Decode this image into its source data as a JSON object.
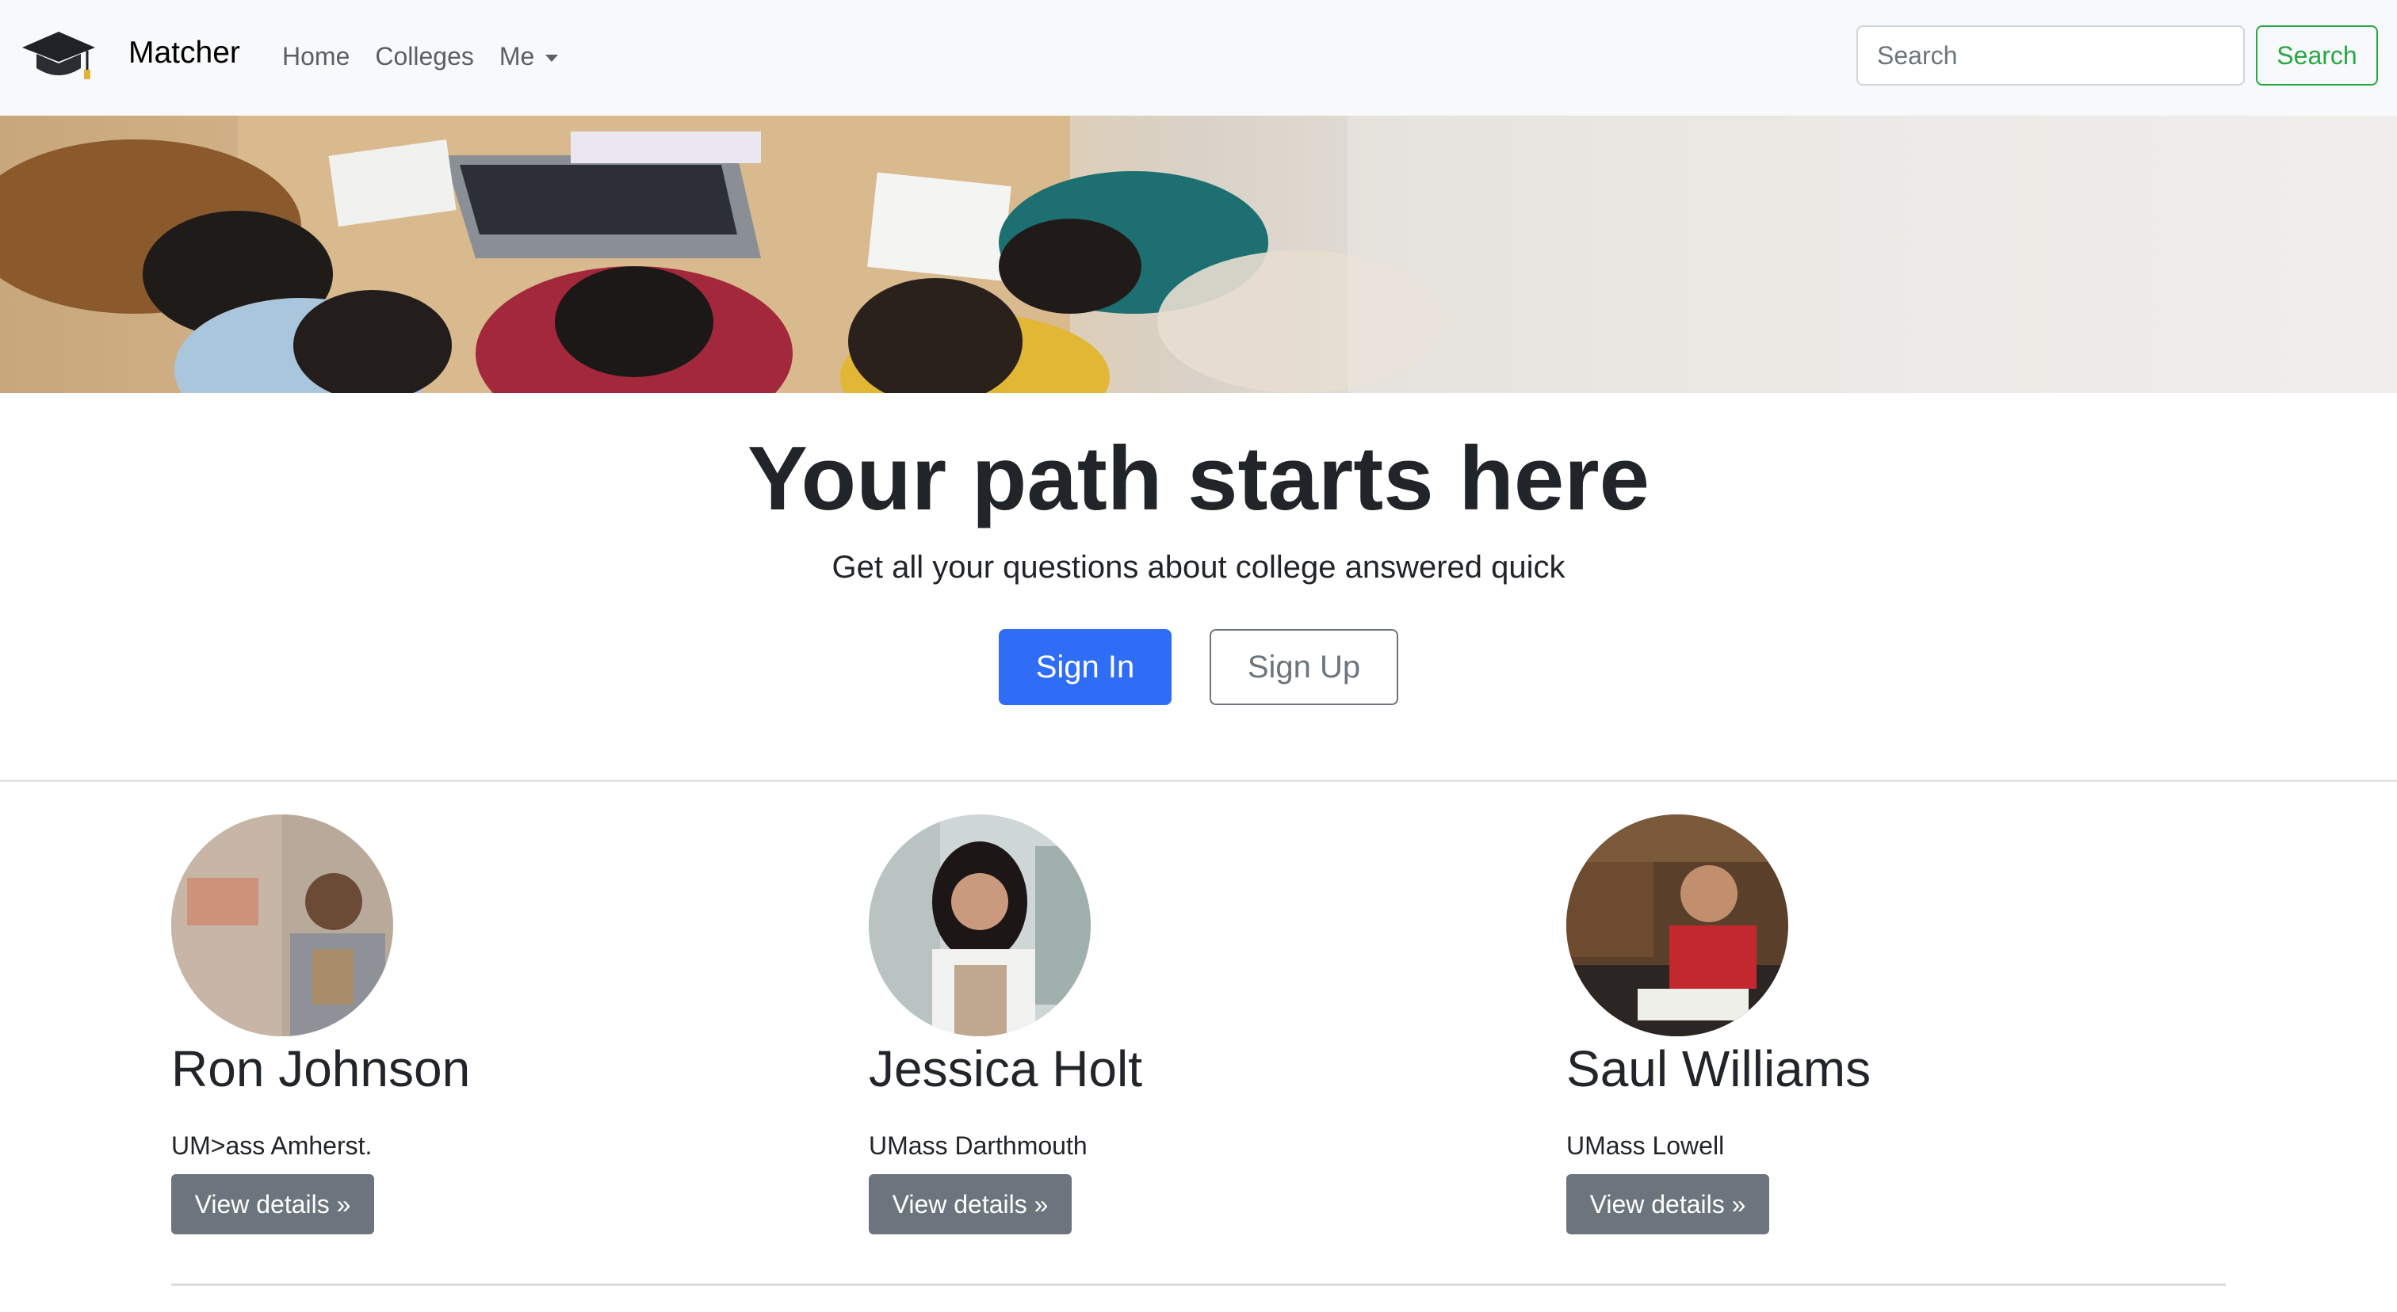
{
  "navbar": {
    "brand": "Matcher",
    "links": [
      {
        "label": "Home"
      },
      {
        "label": "Colleges"
      },
      {
        "label": "Me"
      }
    ],
    "search": {
      "placeholder": "Search",
      "button_label": "Search"
    }
  },
  "hero": {
    "title": "Your path starts here",
    "lead": "Get all your questions about college answered quick",
    "signin_label": "Sign In",
    "signup_label": "Sign Up"
  },
  "cards": [
    {
      "name": "Ron Johnson",
      "school": "UM>ass Amherst.",
      "button_label": "View details »"
    },
    {
      "name": "Jessica Holt",
      "school": "UMass Darthmouth",
      "button_label": "View details »"
    },
    {
      "name": "Saul Williams",
      "school": "UMass Lowell",
      "button_label": "View details »"
    }
  ],
  "colors": {
    "primary": "#2f6df6",
    "success": "#28a745",
    "secondary": "#6c757d",
    "navbar_bg": "#f8f9fa"
  },
  "icons": {
    "brand": "graduation-cap-icon",
    "dropdown": "caret-down-icon"
  }
}
